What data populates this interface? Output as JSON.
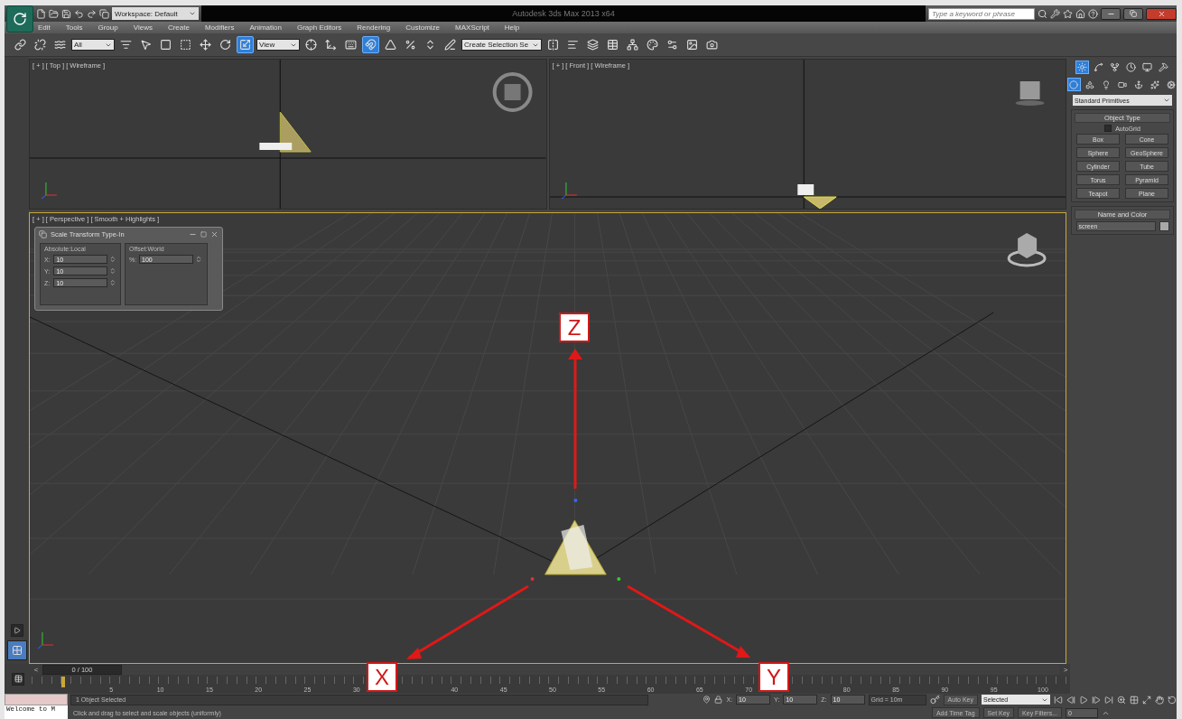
{
  "title_bar": {
    "workspace": "Workspace: Default",
    "title": "Autodesk 3ds Max 2013 x64",
    "search": {
      "placeholder": "Type a keyword or phrase"
    }
  },
  "menu": [
    "Edit",
    "Tools",
    "Group",
    "Views",
    "Create",
    "Modifiers",
    "Animation",
    "Graph Editors",
    "Rendering",
    "Customize",
    "MAXScript",
    "Help"
  ],
  "toolbar": [
    {
      "kind": "tool",
      "selected": false
    },
    {
      "kind": "tool",
      "selected": false
    },
    {
      "kind": "tool",
      "selected": false
    },
    {
      "kind": "dropdown",
      "value": "All"
    },
    {
      "kind": "tool",
      "selected": false
    },
    {
      "kind": "tool",
      "selected": false
    },
    {
      "kind": "tool",
      "selected": false
    },
    {
      "kind": "tool",
      "selected": false
    },
    {
      "kind": "tool",
      "selected": false
    },
    {
      "kind": "tool",
      "selected": false
    },
    {
      "kind": "tool",
      "selected": true
    },
    {
      "kind": "dropdown",
      "value": "View"
    },
    {
      "kind": "tool",
      "selected": false
    },
    {
      "kind": "tool",
      "selected": false
    },
    {
      "kind": "tool",
      "selected": false
    },
    {
      "kind": "tool",
      "selected": true
    },
    {
      "kind": "tool",
      "selected": false
    },
    {
      "kind": "tool",
      "selected": false
    },
    {
      "kind": "tool",
      "selected": false
    },
    {
      "kind": "tool",
      "selected": false
    },
    {
      "kind": "dropdown",
      "value": "Create Selection Se"
    },
    {
      "kind": "tool",
      "selected": false
    },
    {
      "kind": "tool",
      "selected": false
    },
    {
      "kind": "tool",
      "selected": false
    },
    {
      "kind": "tool",
      "selected": false
    },
    {
      "kind": "tool",
      "selected": false
    },
    {
      "kind": "tool",
      "selected": false
    },
    {
      "kind": "tool",
      "selected": false
    },
    {
      "kind": "tool",
      "selected": false
    },
    {
      "kind": "tool",
      "selected": false
    }
  ],
  "viewports": {
    "top": {
      "label": "[ + ] [ Top ] [ Wireframe ]"
    },
    "front": {
      "label": "[ + ] [ Front ] [ Wireframe ]"
    },
    "perspective": {
      "label": "[ + ] [ Perspective ] [ Smooth + Highlights ]",
      "active": true
    }
  },
  "dialog": {
    "title": "Scale Transform Type-In",
    "absolute": {
      "title": "Absolute:Local",
      "fields": [
        {
          "label": "X:",
          "value": "10"
        },
        {
          "label": "Y:",
          "value": "10"
        },
        {
          "label": "Z:",
          "value": "10"
        }
      ]
    },
    "offset": {
      "title": "Offset:World",
      "fields": [
        {
          "label": "%:",
          "value": "100"
        }
      ]
    }
  },
  "annotations": [
    {
      "label": "Z"
    },
    {
      "label": "X"
    },
    {
      "label": "Y"
    }
  ],
  "command_panel": {
    "tabs": [
      {
        "selected": true
      },
      {
        "selected": false
      },
      {
        "selected": false
      },
      {
        "selected": false
      },
      {
        "selected": false
      },
      {
        "selected": false
      }
    ],
    "categories": [
      {
        "selected": true
      },
      {
        "selected": false
      },
      {
        "selected": false
      },
      {
        "selected": false
      },
      {
        "selected": false
      },
      {
        "selected": false
      },
      {
        "selected": false
      }
    ],
    "dropdown": "Standard Primitives",
    "object_type": {
      "title": "Object Type",
      "autogrid": {
        "label": "AutoGrid",
        "checked": false
      },
      "buttons": [
        "Box",
        "Cone",
        "Sphere",
        "GeoSphere",
        "Cylinder",
        "Tube",
        "Torus",
        "Pyramid",
        "Teapot",
        "Plane"
      ]
    },
    "name_and_color": {
      "title": "Name and Color",
      "name": "screen"
    }
  },
  "timeline": {
    "prev": "<",
    "slider": "0 / 100",
    "level": 0,
    "next": ">",
    "ruler": [
      {
        "kind": "label",
        "label": "5"
      },
      {
        "kind": "label",
        "label": "10"
      },
      {
        "kind": "label",
        "label": "15"
      },
      {
        "kind": "label",
        "label": "20"
      },
      {
        "kind": "label",
        "label": "25"
      },
      {
        "kind": "label",
        "label": "30"
      },
      {
        "kind": "covered"
      },
      {
        "kind": "label",
        "label": "40"
      },
      {
        "kind": "label",
        "label": "45"
      },
      {
        "kind": "label",
        "label": "50"
      },
      {
        "kind": "label",
        "label": "55"
      },
      {
        "kind": "label",
        "label": "60"
      },
      {
        "kind": "label",
        "label": "65"
      },
      {
        "kind": "label",
        "label": "70"
      },
      {
        "kind": "covered"
      },
      {
        "kind": "label",
        "label": "80"
      },
      {
        "kind": "label",
        "label": "85"
      },
      {
        "kind": "label",
        "label": "90"
      },
      {
        "kind": "label",
        "label": "95"
      },
      {
        "kind": "label",
        "label": "100"
      }
    ]
  },
  "status": {
    "listener": "Welcome to M",
    "selection": "1 Object Selected",
    "prompt": "Click and drag to select and scale objects (uniformly)",
    "coords": [
      {
        "label": "X:",
        "value": "10"
      },
      {
        "label": "Y:",
        "value": "10"
      },
      {
        "label": "Z:",
        "value": "10"
      }
    ],
    "grid": "Grid = 10m",
    "time_tag": "Add Time Tag",
    "auto_key": "Auto Key",
    "key_mode": "Selected",
    "set_key": "Set Key",
    "key_filters": "Key Filters...",
    "frame": "0"
  }
}
